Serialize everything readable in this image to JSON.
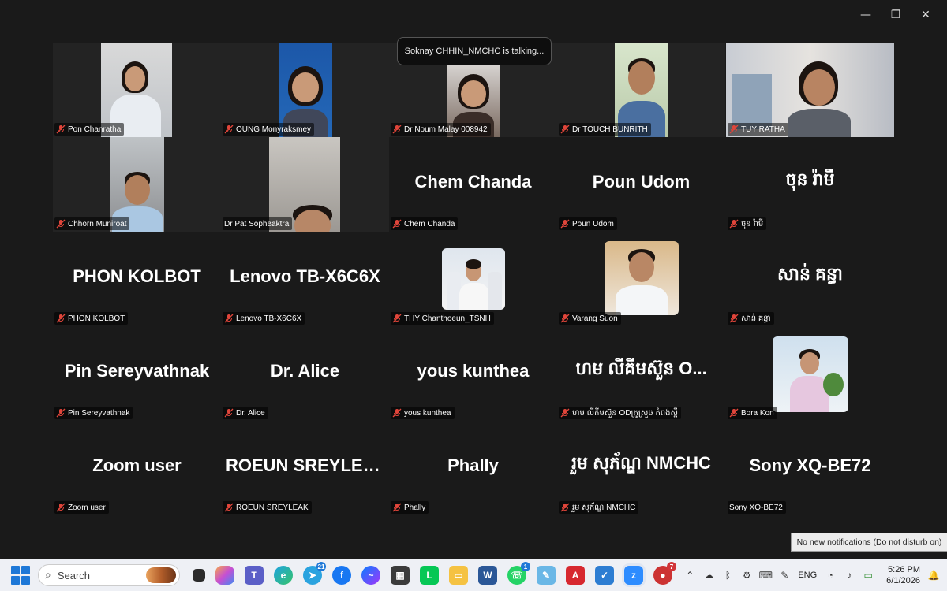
{
  "window": {
    "minimize": "—",
    "restore": "❐",
    "close": "✕"
  },
  "speaking": "Soknay CHHIN_NMCHC is talking...",
  "participants": [
    {
      "label": "Pon Chanratha",
      "big": "",
      "video": true
    },
    {
      "label": "OUNG Monyraksmey",
      "big": "",
      "video": true
    },
    {
      "label": "Dr Noum Malay 008942",
      "big": "",
      "video": true
    },
    {
      "label": "Dr TOUCH BUNRITH",
      "big": "",
      "video": true
    },
    {
      "label": "TUY RATHA",
      "big": "",
      "video": true
    },
    {
      "label": "Chhorn Muniroat",
      "big": "",
      "video": true
    },
    {
      "label": "Dr Pat Sopheaktra",
      "big": "",
      "video": true
    },
    {
      "label": "Chem Chanda",
      "big": "Chem Chanda",
      "video": false
    },
    {
      "label": "Poun Udom",
      "big": "Poun Udom",
      "video": false
    },
    {
      "label": "ចុន រ៉ាមី",
      "big": "ចុន រ៉ាមី",
      "video": false
    },
    {
      "label": "PHON KOLBOT",
      "big": "PHON KOLBOT",
      "video": false
    },
    {
      "label": "Lenovo TB-X6C6X",
      "big": "Lenovo TB-X6C6X",
      "video": false
    },
    {
      "label": "THY Chanthoeun_TSNH",
      "big": "",
      "video": false
    },
    {
      "label": "Varang Suon",
      "big": "",
      "video": false
    },
    {
      "label": "សាន់ គន្ធា",
      "big": "សាន់ គន្ធា",
      "video": false
    },
    {
      "label": "Pin Sereyvathnak",
      "big": "Pin Sereyvathnak",
      "video": false
    },
    {
      "label": "Dr. Alice",
      "big": "Dr. Alice",
      "video": false
    },
    {
      "label": "yous kunthea",
      "big": "yous kunthea",
      "video": false
    },
    {
      "label": "ហម លីគីមស៊ួន ODគ្រូស្រួច កំពង់ស្ពឺ",
      "big": "ហម លីគីមស៊ួន O...",
      "video": false
    },
    {
      "label": "Bora Kon",
      "big": "",
      "video": false
    },
    {
      "label": "Zoom user",
      "big": "Zoom user",
      "video": false
    },
    {
      "label": "ROEUN SREYLEAK",
      "big": "ROEUN SREYLEAK",
      "video": false
    },
    {
      "label": "Phally",
      "big": "Phally",
      "video": false
    },
    {
      "label": "រួម សុភ័ណ្ឌ NMCHC",
      "big": "រួម សុភ័ណ្ឌ NMCHC",
      "video": false
    },
    {
      "label": "Sony XQ-BE72",
      "big": "Sony XQ-BE72",
      "video": false
    }
  ],
  "notification": "No new notifications (Do not disturb on)",
  "taskbar": {
    "search_placeholder": "Search",
    "badges": {
      "telegram": "21",
      "whatsapp": "1",
      "red_app": "7"
    },
    "language": "ENG",
    "time": "5:26 PM",
    "date": "6/1/2026"
  },
  "colors": {
    "mic_off": "#e0453a",
    "background": "#1a1a1a",
    "taskbar": "#eef0f5"
  }
}
